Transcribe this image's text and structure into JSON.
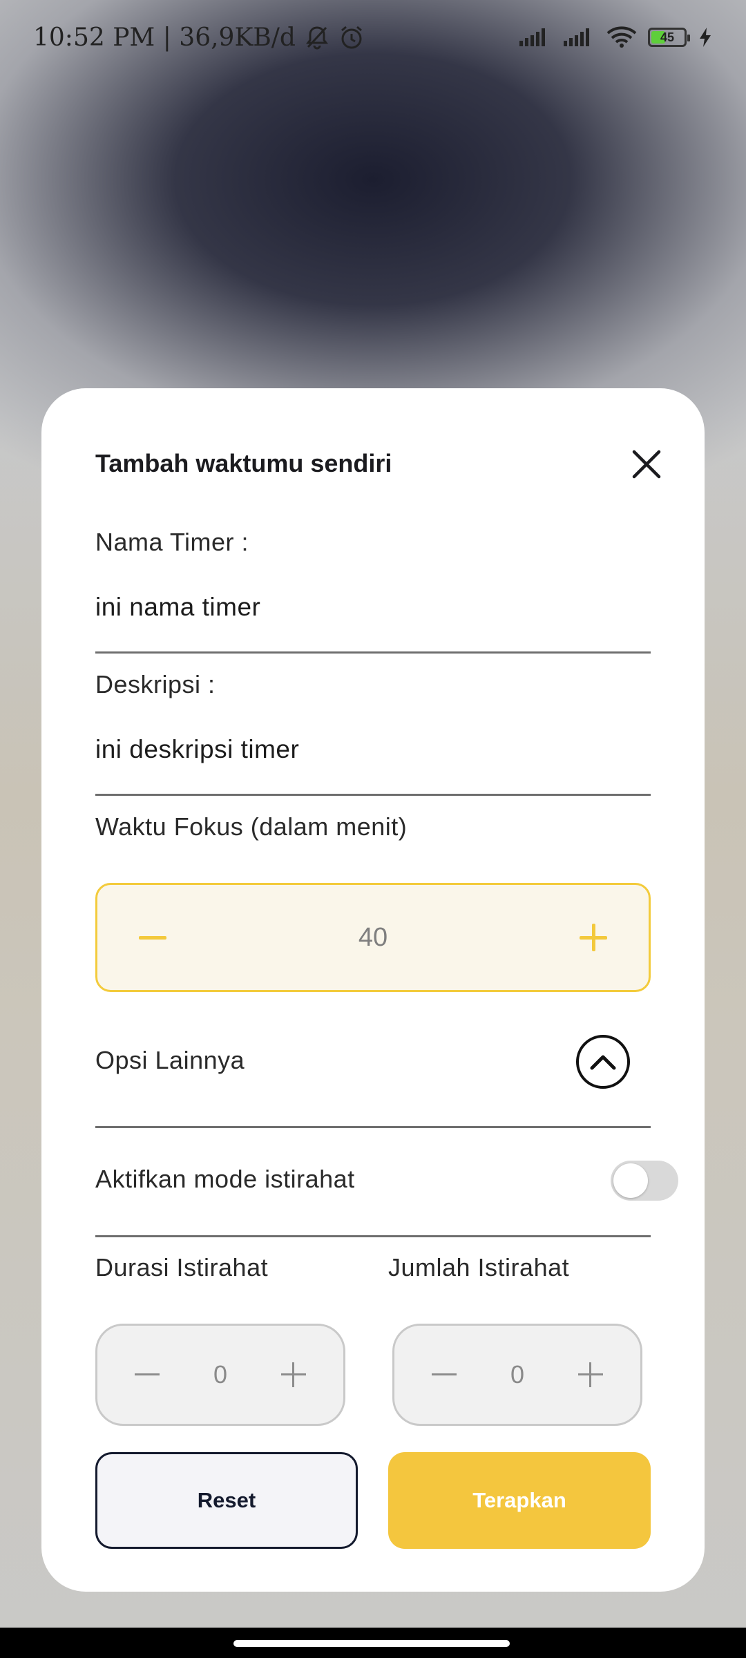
{
  "status_bar": {
    "time_info": "10:52 PM | 36,9KB/d",
    "battery_level": "45",
    "icons": [
      "mute-bell-icon",
      "alarm-icon",
      "signal-icon",
      "signal-icon",
      "wifi-icon",
      "battery-icon",
      "charging-icon"
    ]
  },
  "modal": {
    "title": "Tambah waktumu sendiri",
    "name_label": "Nama Timer :",
    "name_value": "ini nama timer",
    "desc_label": "Deskripsi :",
    "desc_value": "ini deskripsi timer",
    "focus_label": "Waktu Fokus (dalam menit)",
    "focus_value": "40",
    "more_options_label": "Opsi Lainnya",
    "break_mode_label": "Aktifkan mode istirahat",
    "break_mode_enabled": false,
    "break_duration_label": "Durasi Istirahat",
    "break_count_label": "Jumlah Istirahat",
    "break_duration_value": "0",
    "break_count_value": "0",
    "reset_label": "Reset",
    "apply_label": "Terapkan"
  },
  "colors": {
    "accent": "#f4c63e",
    "dark": "#141a2e"
  }
}
